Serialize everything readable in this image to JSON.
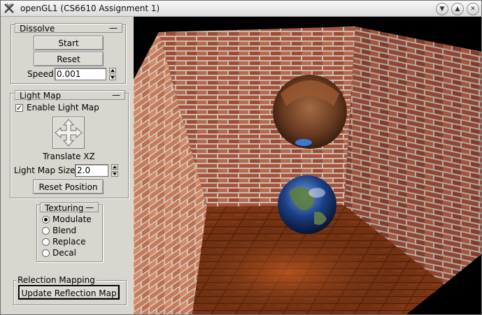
{
  "window": {
    "title": "openGL1 (CS6610 Assignment 1)"
  },
  "dissolve": {
    "header": "Dissolve",
    "start_label": "Start",
    "reset_label": "Reset",
    "speed_label": "Speed",
    "speed_value": "0.001"
  },
  "light_map": {
    "header": "Light Map",
    "enable_label": "Enable Light Map",
    "enable_checked": true,
    "translate_label": "Translate XZ",
    "size_label": "Light Map Size",
    "size_value": "2.0",
    "reset_position_label": "Reset Position"
  },
  "texturing": {
    "header": "Texturing",
    "options": [
      "Modulate",
      "Blend",
      "Replace",
      "Decal"
    ],
    "selected": "Modulate"
  },
  "reflection": {
    "header": "Relection Mapping",
    "update_label": "Update Reflection Map"
  },
  "colors": {
    "panel": "#d9d6cf",
    "brick": "#a8553d",
    "mortar": "#c8bcae",
    "floor": "#7a3413"
  }
}
